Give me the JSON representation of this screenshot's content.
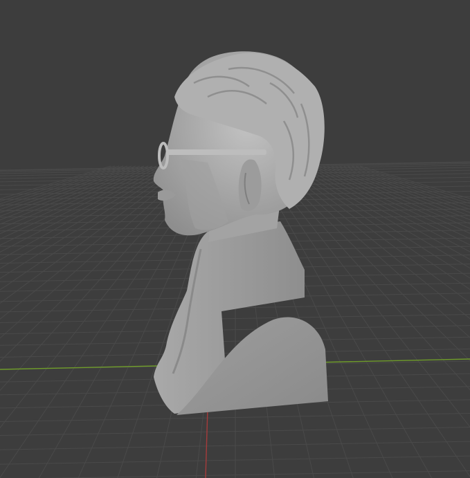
{
  "viewport": {
    "background": "#3d3d3d",
    "grid_color": "#4a4a4a",
    "x_axis_color": "#6f9c2a",
    "y_axis_color": "#a63b3b"
  },
  "model": {
    "description": "bust",
    "fill": "#a9a9a9",
    "shadow": "#8c8c8c",
    "highlight": "#c4c4c4"
  }
}
